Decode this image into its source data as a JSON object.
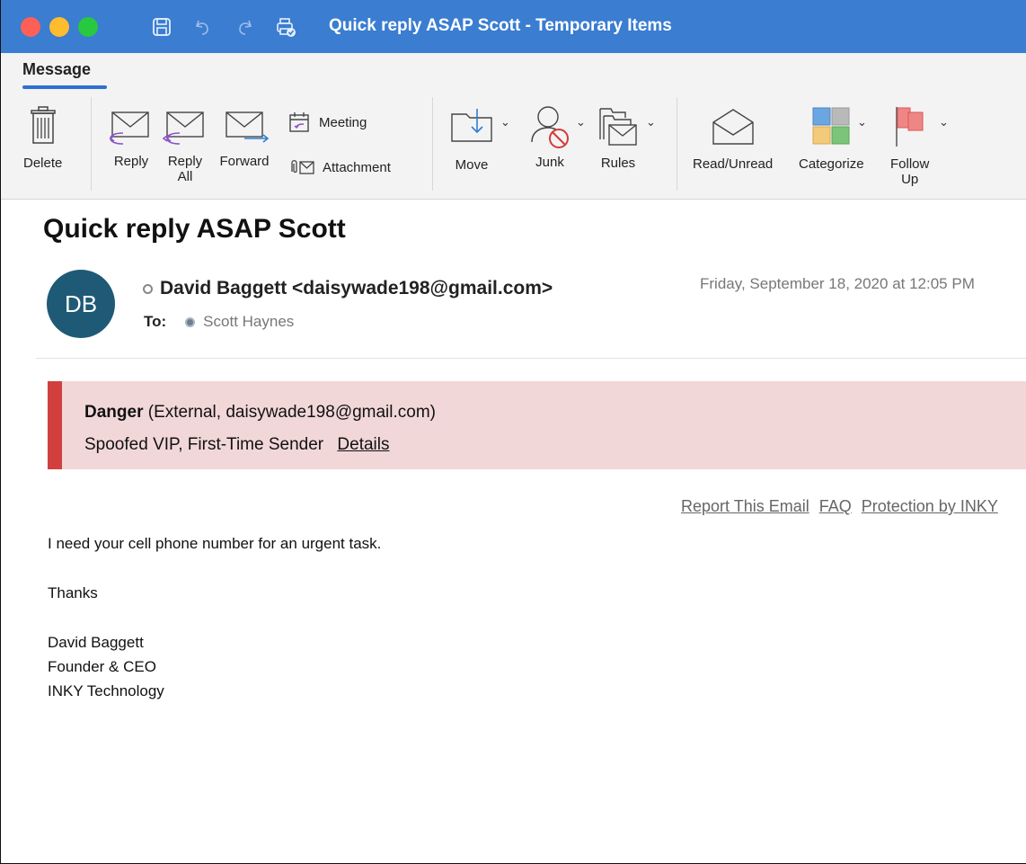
{
  "window": {
    "title": "Quick reply ASAP Scott - Temporary Items",
    "colors": {
      "titlebar": "#3a7dd1",
      "ribbon": "#f3f3f3",
      "accent": "#2f6fd0"
    }
  },
  "titlebar_icons": [
    "save-icon",
    "undo-icon",
    "redo-icon",
    "print-icon"
  ],
  "ribbon": {
    "active_tab": "Message",
    "buttons": {
      "delete": "Delete",
      "reply": "Reply",
      "reply_all_1": "Reply",
      "reply_all_2": "All",
      "forward": "Forward",
      "meeting": "Meeting",
      "attachment": "Attachment",
      "move": "Move",
      "junk": "Junk",
      "rules": "Rules",
      "read_unread": "Read/Unread",
      "categorize": "Categorize",
      "follow_up_1": "Follow",
      "follow_up_2": "Up"
    }
  },
  "message": {
    "subject": "Quick reply ASAP Scott",
    "avatar_initials": "DB",
    "avatar_color": "#1e5a75",
    "from": "David Baggett <daisywade198@gmail.com>",
    "to_label": "To:",
    "to_name": "Scott Haynes",
    "date": "Friday, September 18, 2020 at 12:05 PM"
  },
  "warning": {
    "level": "Danger",
    "detail": "(External, daisywade198@gmail.com)",
    "reasons": "Spoofed VIP, First-Time Sender",
    "details_link": "Details",
    "bar_color": "#d23f3f",
    "bg_color": "#f2d7d9"
  },
  "links": {
    "report": "Report This Email",
    "faq": "FAQ",
    "protection": "Protection by INKY"
  },
  "body": {
    "line1": "I need your cell phone number for an urgent task.",
    "line2": "Thanks",
    "sig1": "David Baggett",
    "sig2": "Founder & CEO",
    "sig3": "INKY Technology"
  }
}
